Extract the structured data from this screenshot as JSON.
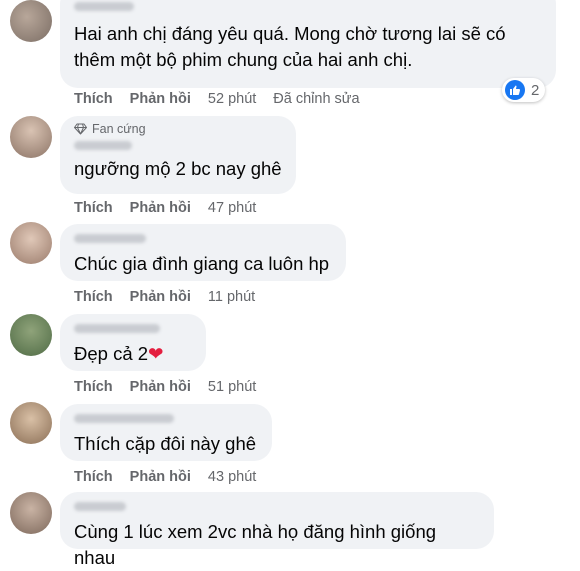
{
  "labels": {
    "like": "Thích",
    "reply": "Phản hồi",
    "edited": "Đã chỉnh sửa"
  },
  "comments": [
    {
      "text": "Hai anh chị đáng yêu quá. Mong chờ tương lai sẽ có thêm một bộ phim chung của hai anh chị.",
      "time": "52 phút",
      "reactions": "2"
    },
    {
      "badge": "Fan cứng",
      "text": "ngưỡng mộ 2 bc nay ghê",
      "time": "47 phút"
    },
    {
      "text": "Chúc gia đình giang ca luôn hp",
      "time": "11 phút"
    },
    {
      "text": "Đẹp cả 2",
      "emoji": "❤",
      "time": "51 phút"
    },
    {
      "text": "Thích cặp đôi này ghê",
      "time": "43 phút"
    },
    {
      "text": "Cùng 1 lúc xem 2vc nhà họ đăng hình giống nhau"
    }
  ],
  "colors": {
    "bubble": "#f0f2f5",
    "meta": "#65676b",
    "like_blue": "#1877f2",
    "heart": "#e41e3f"
  }
}
